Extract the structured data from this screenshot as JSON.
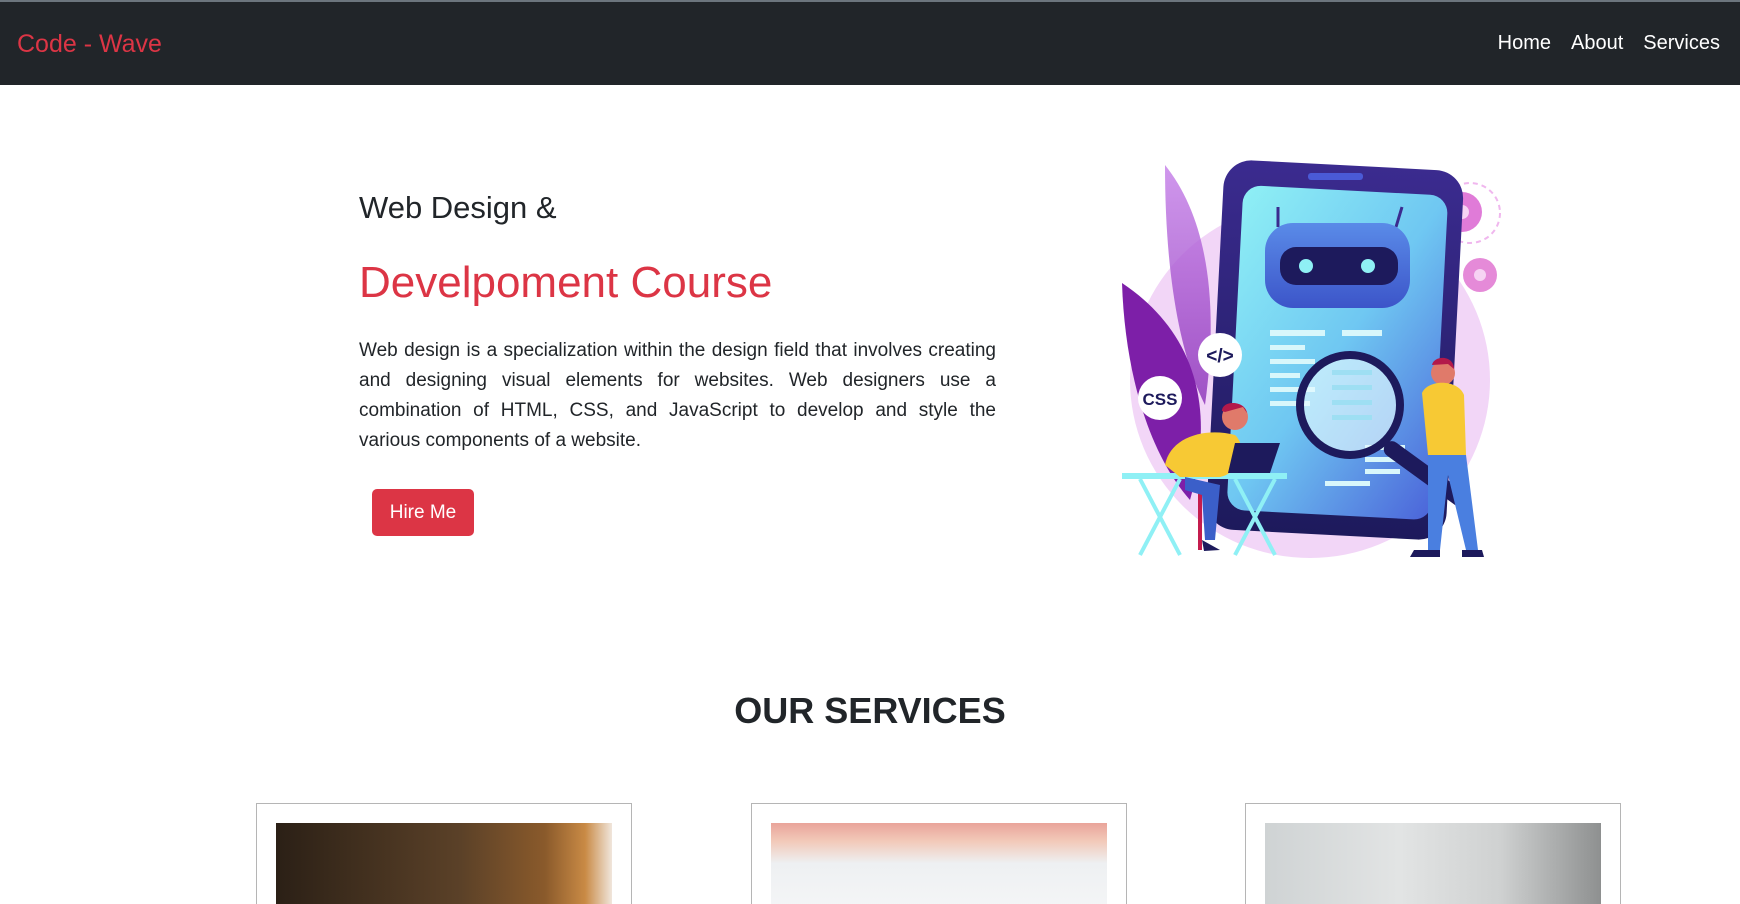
{
  "nav": {
    "brand": "Code - Wave",
    "links": [
      "Home",
      "About",
      "Services"
    ]
  },
  "hero": {
    "kicker": "Web Design &",
    "title": "Develpoment Course",
    "description": "Web design is a specialization within the design field that involves creating and designing visual elements for websites. Web designers use a combination of HTML, CSS, and JavaScript to develop and style the various components of a website.",
    "cta_label": "Hire Me",
    "illustration": {
      "badge_code": "</>",
      "badge_css": "CSS"
    }
  },
  "services": {
    "title": "OUR SERVICES"
  },
  "colors": {
    "accent": "#dc3545",
    "navbar": "#212529"
  }
}
